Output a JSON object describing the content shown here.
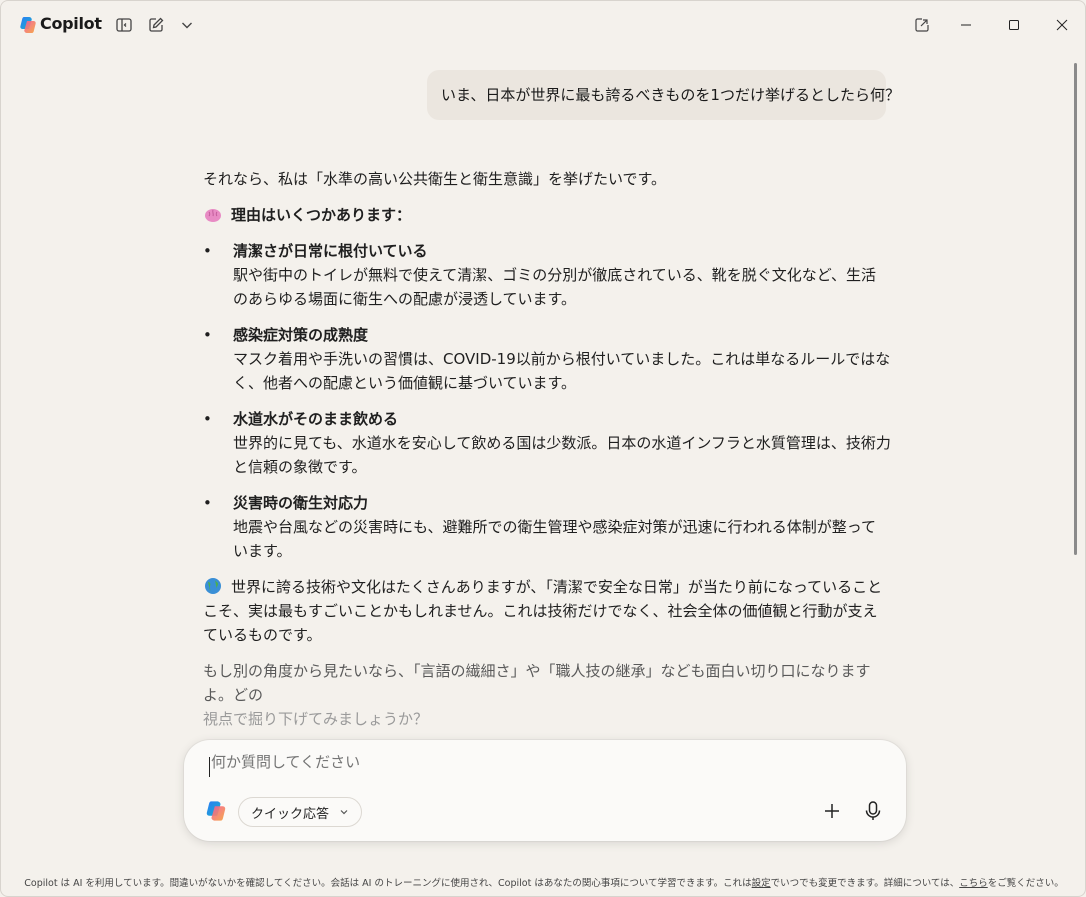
{
  "titlebar": {
    "app_name": "Copilot",
    "icons": [
      "copilot-logo",
      "sidebar-toggle-icon",
      "new-chat-icon",
      "chevron-down-icon",
      "popout-icon",
      "minimize-icon",
      "maximize-icon",
      "close-icon"
    ]
  },
  "conversation": {
    "user_message": "いま、日本が世界に最も誇るべきものを1つだけ挙げるとしたら何？",
    "response": {
      "intro": "それなら、私は「水準の高い公共衛生と衛生意識」を挙げたいです。",
      "heading": "理由はいくつかあります：",
      "heading_emoji": "brain-emoji",
      "bullet": "•",
      "items": [
        {
          "title": "清潔さが日常に根付いている",
          "body": "駅や街中のトイレが無料で使えて清潔、ゴミの分別が徹底されている、靴を脱ぐ文化など、生活のあらゆる場面に衛生への配慮が浸透しています。"
        },
        {
          "title": "感染症対策の成熟度",
          "body": "マスク着用や手洗いの習慣は、COVID-19以前から根付いていました。これは単なるルールではなく、他者への配慮という価値観に基づいています。"
        },
        {
          "title": "水道水がそのまま飲める",
          "body": "世界的に見ても、水道水を安心して飲める国は少数派。日本の水道インフラと水質管理は、技術力と信頼の象徴です。"
        },
        {
          "title": "災害時の衛生対応力",
          "body": "地震や台風などの災害時にも、避難所での衛生管理や感染症対策が迅速に行われる体制が整っています。"
        }
      ],
      "closing_emoji": "globe-emoji",
      "closing": "世界に誇る技術や文化はたくさんありますが、「清潔で安全な日常」が当たり前になっていることこそ、実は最もすごいことかもしれません。これは技術だけでなく、社会全体の価値観と行動が支えているものです。",
      "followup_line1": "もし別の角度から見たいなら、「言語の繊細さ」や「職人技の継承」なども面白い切り口になりますよ。どの",
      "followup_line2": "視点で掘り下げてみましょうか？"
    }
  },
  "composer": {
    "placeholder": "何か質問してください",
    "quick_label": "クイック応答",
    "icons": [
      "copilot-icon",
      "chevron-down-icon",
      "plus-icon",
      "microphone-icon"
    ]
  },
  "footer": {
    "text_before": "Copilot は AI を利用しています。間違いがないかを確認してください。会話は AI のトレーニングに使用され、Copilot はあなたの関心事項について学習できます。これは",
    "settings_link": "設定",
    "text_middle": "でいつでも変更できます。詳細については、",
    "here_link": "こちら",
    "text_after": "をご覧ください。"
  },
  "colors": {
    "background": "#f4f1ec",
    "user_bubble": "#ebe6df",
    "composer": "#fbfaf8"
  }
}
